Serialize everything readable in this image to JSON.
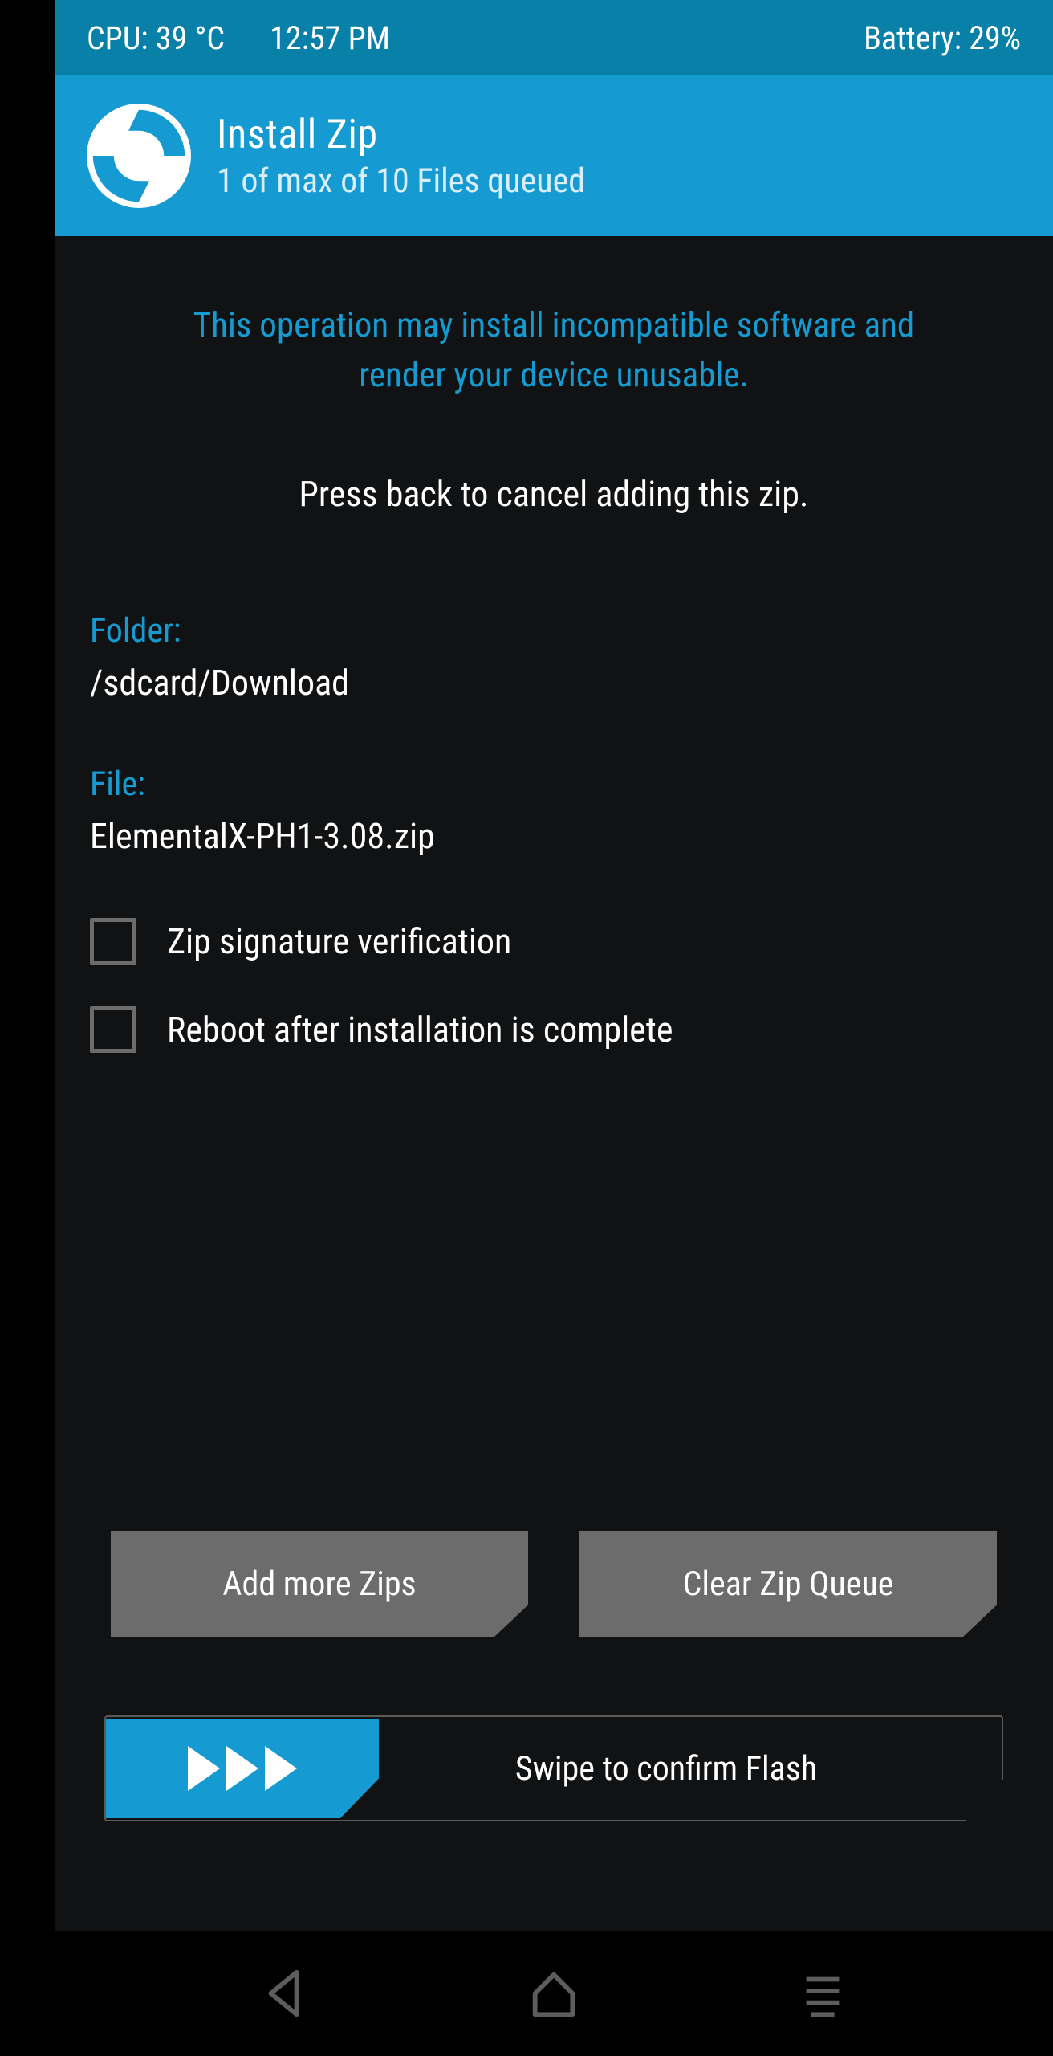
{
  "statusbar": {
    "cpu": "CPU: 39 °C",
    "time": "12:57 PM",
    "battery": "Battery: 29%"
  },
  "header": {
    "title": "Install Zip",
    "subtitle": "1 of max of 10 Files queued"
  },
  "content": {
    "warning": "This operation may install incompatible software and render your device unusable.",
    "hint": "Press back to cancel adding this zip.",
    "folder_label": "Folder:",
    "folder_value": "/sdcard/Download",
    "file_label": "File:",
    "file_value": "ElementalX-PH1-3.08.zip",
    "zip_sig_label": "Zip signature verification",
    "reboot_label": "Reboot after installation is complete",
    "add_more_label": "Add more Zips",
    "clear_queue_label": "Clear Zip Queue",
    "swipe_label": "Swipe to confirm Flash"
  }
}
